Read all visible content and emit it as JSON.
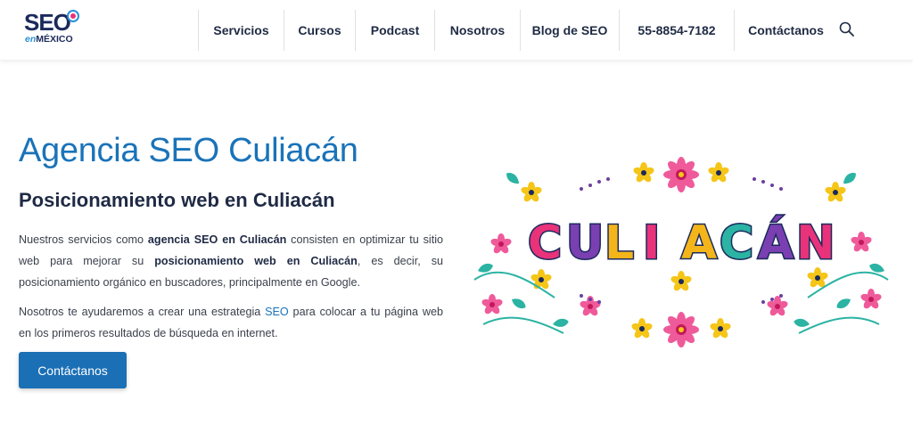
{
  "header": {
    "logo": {
      "main": "SEO",
      "sub_en": "en",
      "sub_rest": "MÉXICO"
    },
    "nav": [
      {
        "label": "Servicios",
        "id": "servicios"
      },
      {
        "label": "Cursos",
        "id": "cursos"
      },
      {
        "label": "Podcast",
        "id": "podcast"
      },
      {
        "label": "Nosotros",
        "id": "nosotros"
      },
      {
        "label": "Blog de SEO",
        "id": "blog"
      },
      {
        "label": "55-8854-7182",
        "id": "telefono"
      },
      {
        "label": "Contáctanos",
        "id": "contactanos"
      }
    ],
    "search_icon": "search-icon"
  },
  "hero": {
    "title": "Agencia SEO Culiacán",
    "subtitle": "Posicionamiento web en Culiacán",
    "p1_a": "Nuestros servicios como ",
    "p1_b": "agencia SEO en Culiacán",
    "p1_c": "  consisten en optimizar tu sitio web para mejorar su ",
    "p1_d": "posicionamiento web en Culiacán",
    "p1_e": ", es decir, su posicionamiento orgánico en buscadores, principalmente en Google.",
    "p2_a": "Nosotros te ayudaremos a crear una estrategia ",
    "p2_link": "SEO",
    "p2_b": " para colocar a tu página web en los primeros resultados de búsqueda en internet.",
    "cta_label": "Contáctanos"
  },
  "illustration": {
    "word": "CULIACÁN",
    "letters": [
      "C",
      "U",
      "L",
      "I",
      "A",
      "C",
      "Á",
      "N"
    ],
    "letter_colors": [
      "#e8327a",
      "#7a3fb0",
      "#f3b519",
      "#e8327a",
      "#f3b519",
      "#2bb3a3",
      "#7a3fb0",
      "#e8327a"
    ],
    "flower_colors": {
      "pink": "#ef5a9a",
      "yellow": "#f5c518",
      "teal": "#2bb3a3",
      "purple": "#6b3fa0"
    }
  }
}
